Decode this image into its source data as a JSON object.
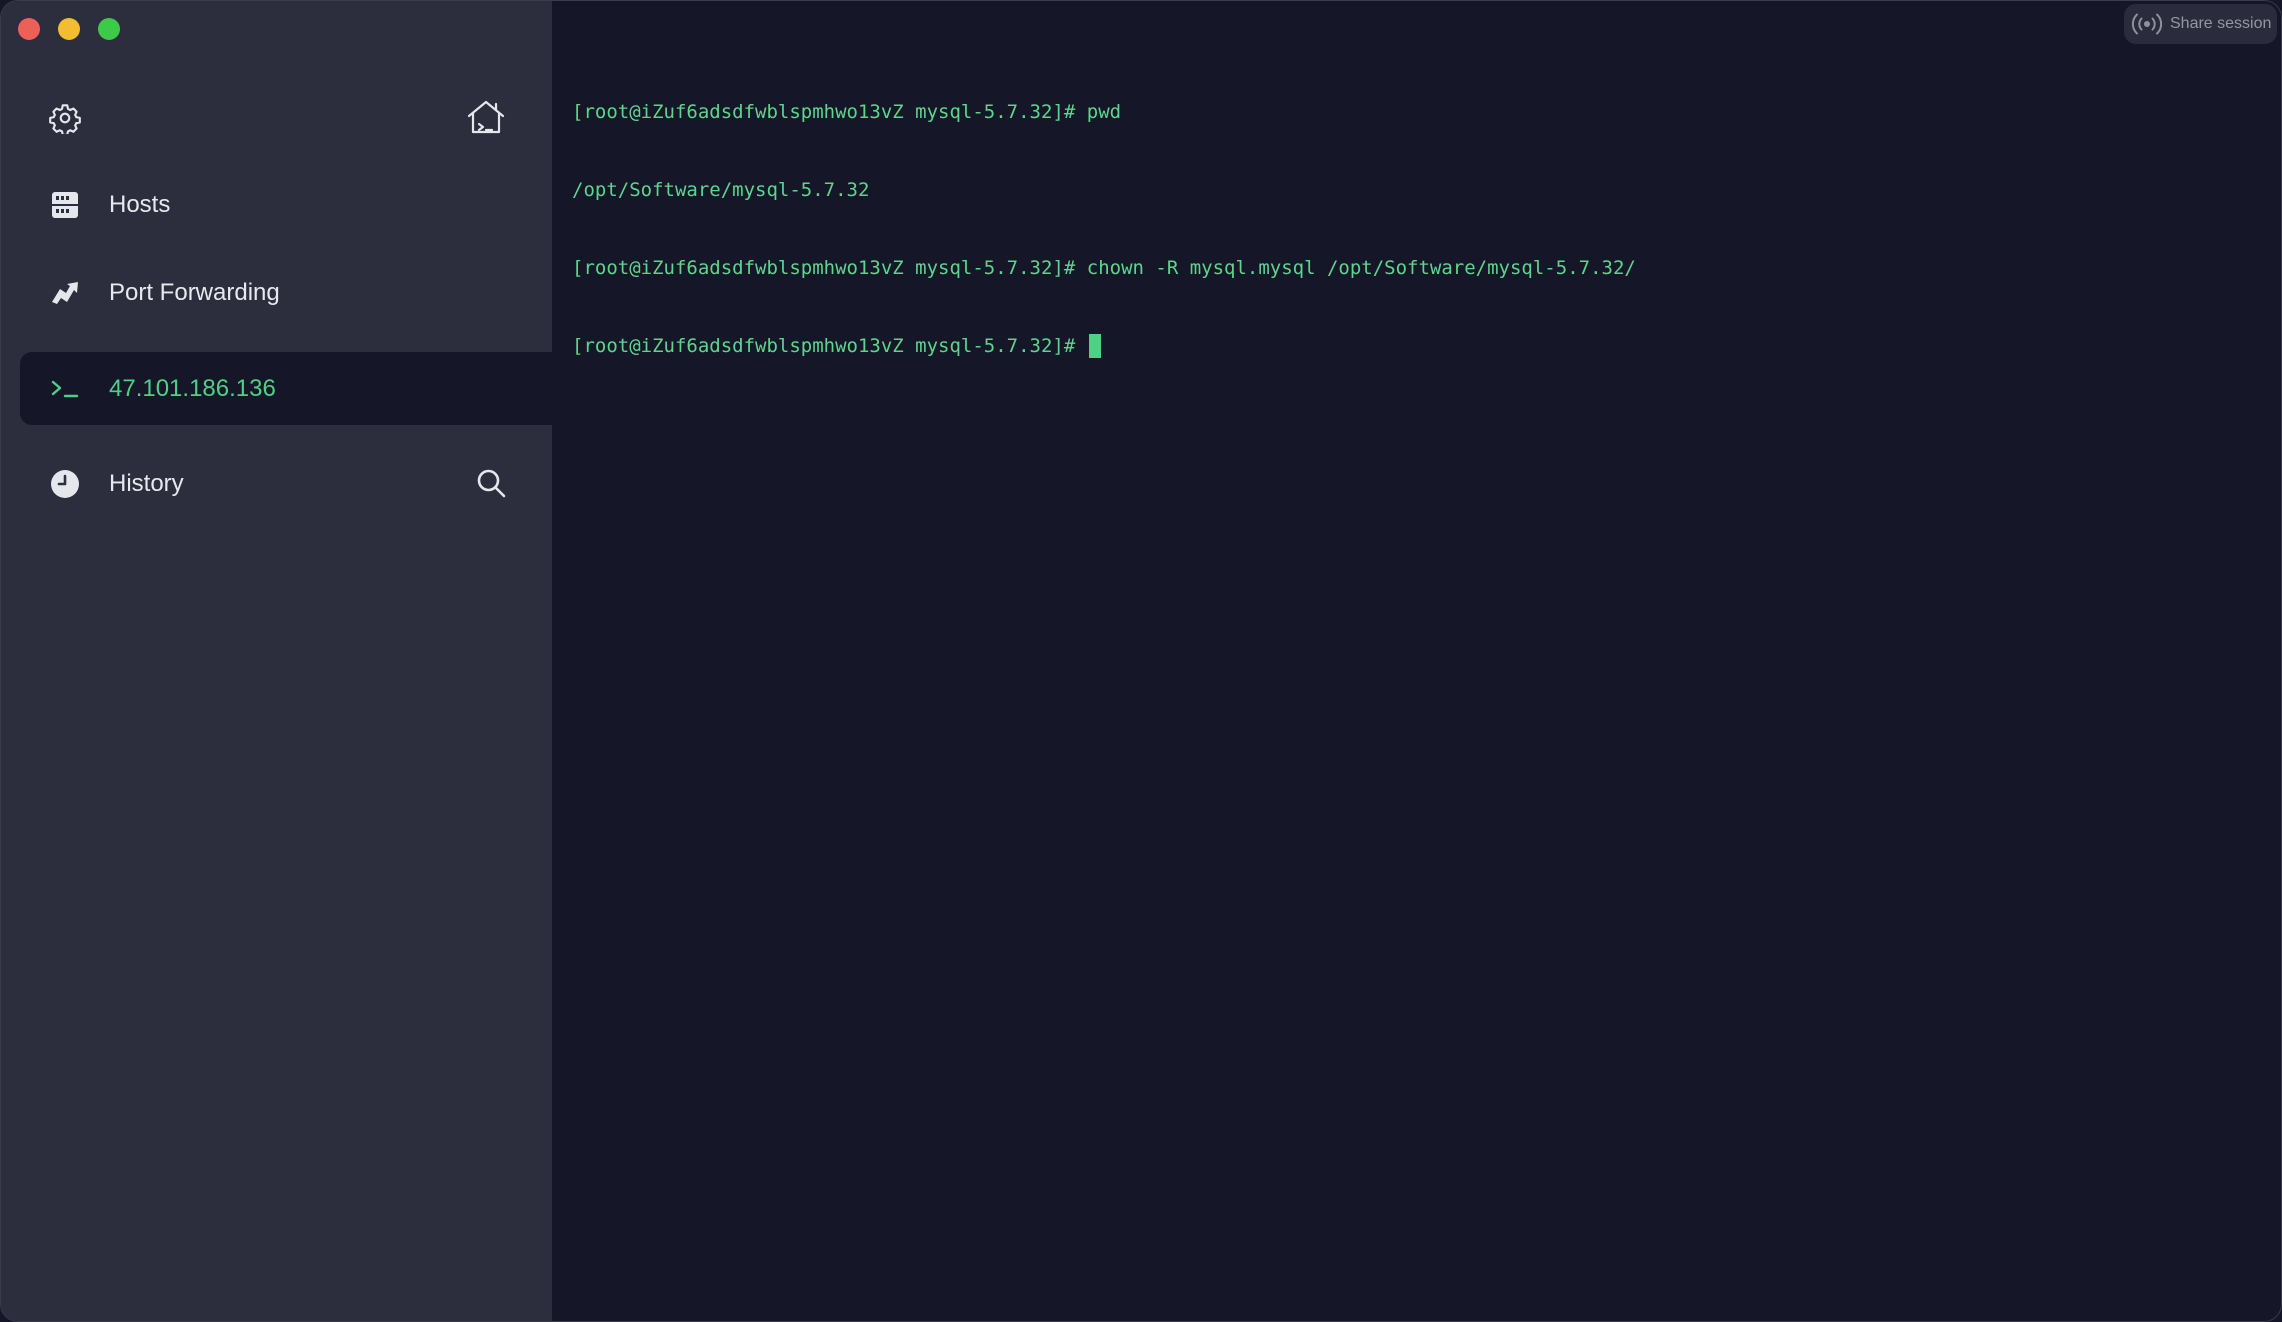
{
  "window": {
    "controls": [
      "close",
      "minimize",
      "maximize"
    ]
  },
  "sidebar": {
    "top_icons": [
      "gear-icon",
      "home-icon"
    ],
    "items": [
      {
        "label": "Hosts",
        "icon": "hosts-icon"
      },
      {
        "label": "Port Forwarding",
        "icon": "port-forwarding-icon"
      },
      {
        "label": "47.101.186.136",
        "icon": "terminal-prompt-icon",
        "active": true
      },
      {
        "label": "History",
        "icon": "clock-icon"
      }
    ],
    "history_search_icon": "search-icon"
  },
  "terminal": {
    "lines": [
      "[root@iZuf6adsdfwblspmhwo13vZ mysql-5.7.32]# pwd",
      "/opt/Software/mysql-5.7.32",
      "[root@iZuf6adsdfwblspmhwo13vZ mysql-5.7.32]# chown -R mysql.mysql /opt/Software/mysql-5.7.32/",
      "[root@iZuf6adsdfwblspmhwo13vZ mysql-5.7.32]# "
    ],
    "text_color": "#5fd58c"
  },
  "share": {
    "label": "Share session",
    "icon": "broadcast-icon"
  },
  "colors": {
    "sidebar_bg": "#2c2e3d",
    "terminal_bg": "#151728",
    "accent": "#4fd084"
  }
}
